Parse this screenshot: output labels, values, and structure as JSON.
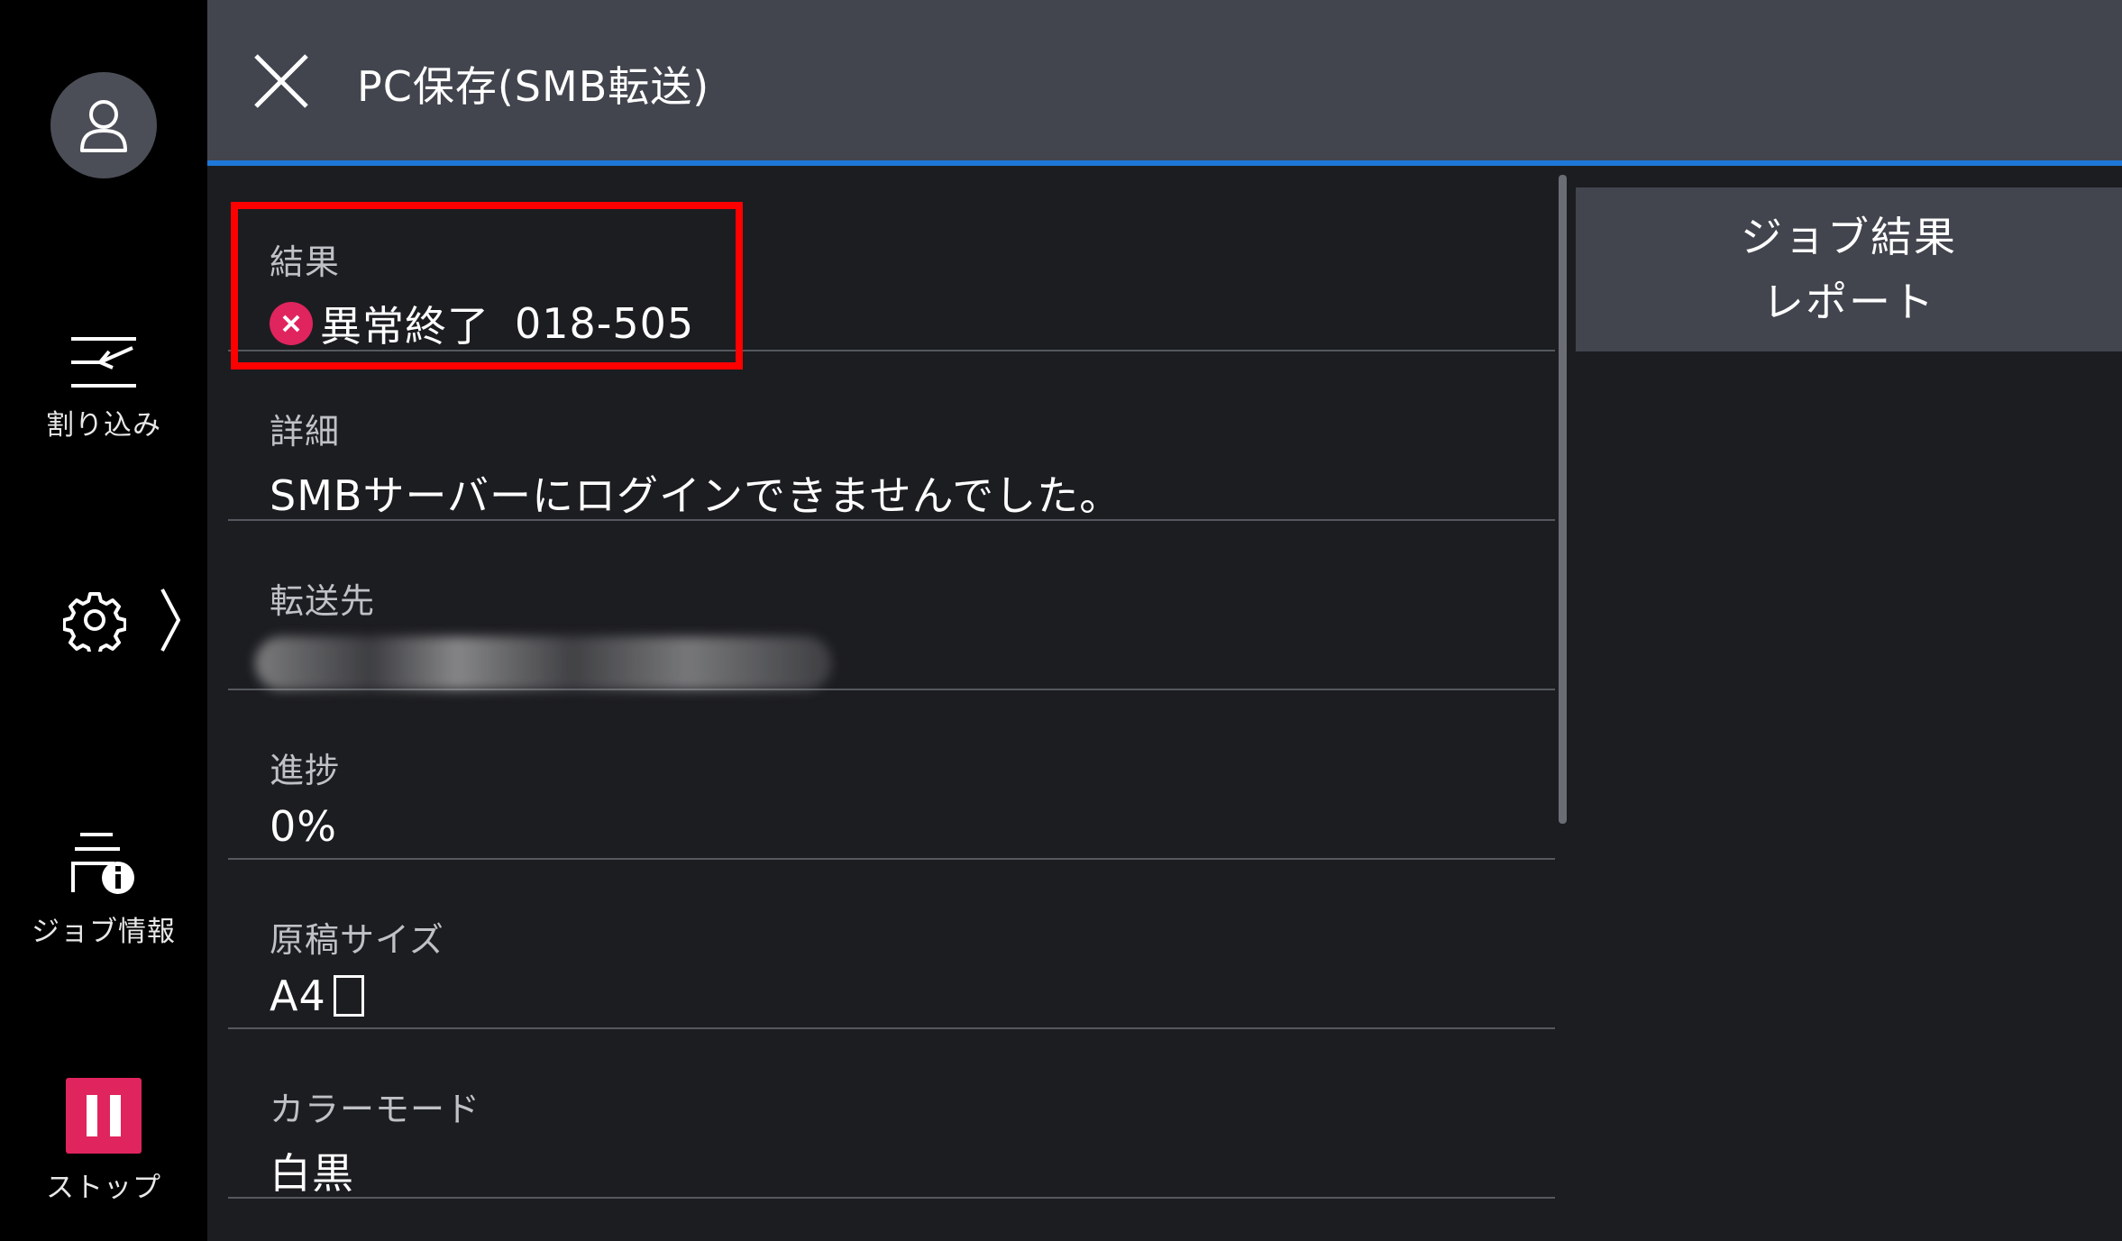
{
  "header": {
    "title": "PC保存(SMB転送)"
  },
  "rail": {
    "interrupt_label": "割り込み",
    "jobinfo_label": "ジョブ情報",
    "stop_label": "ストップ"
  },
  "details": {
    "result": {
      "label": "結果",
      "status": "異常終了",
      "code": "018-505"
    },
    "detail": {
      "label": "詳細",
      "value": "SMBサーバーにログインできませんでした。"
    },
    "destination": {
      "label": "転送先"
    },
    "progress": {
      "label": "進捗",
      "value": "0%"
    },
    "original_size": {
      "label": "原稿サイズ",
      "value": "A4"
    },
    "color_mode": {
      "label": "カラーモード",
      "value": "白黒"
    }
  },
  "report_button": {
    "line1": "ジョブ結果",
    "line2": "レポート"
  },
  "colors": {
    "accent": "#1e78d7",
    "error": "#e0245e",
    "highlight": "#ff0000"
  },
  "icons": [
    "user-icon",
    "interrupt-icon",
    "gear-icon",
    "chevron-right-icon",
    "job-info-icon",
    "pause-icon",
    "close-icon",
    "error-icon",
    "portrait-orientation-icon"
  ]
}
